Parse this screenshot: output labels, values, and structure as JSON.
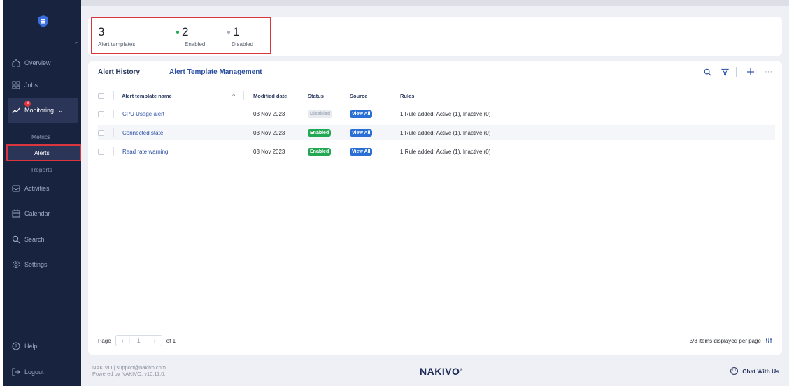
{
  "sidebar": {
    "items": [
      {
        "label": "Overview",
        "icon": "home-icon"
      },
      {
        "label": "Jobs",
        "icon": "grid-icon"
      },
      {
        "label": "Monitoring",
        "icon": "chart-line-icon",
        "badge": "6"
      },
      {
        "label": "Activities",
        "icon": "inbox-icon"
      },
      {
        "label": "Calendar",
        "icon": "calendar-icon"
      },
      {
        "label": "Search",
        "icon": "search-icon"
      },
      {
        "label": "Settings",
        "icon": "gear-icon"
      }
    ],
    "subitems": [
      "Metrics",
      "Alerts",
      "Reports"
    ],
    "bottom": [
      {
        "label": "Help",
        "icon": "help-icon"
      },
      {
        "label": "Logout",
        "icon": "logout-icon"
      }
    ]
  },
  "stats": [
    {
      "value": "3",
      "label": "Alert templates",
      "dot_color": ""
    },
    {
      "value": "2",
      "label": "Enabled",
      "dot_color": "#22a852"
    },
    {
      "value": "1",
      "label": "Disabled",
      "dot_color": "#a6adba"
    }
  ],
  "tabs": [
    "Alert History",
    "Alert Template Management"
  ],
  "table": {
    "columns": [
      "Alert template name",
      "Modified date",
      "Status",
      "Source",
      "Rules"
    ],
    "sort_indicator": "^",
    "rows": [
      {
        "name": "CPU Usage alert",
        "date": "03 Nov 2023",
        "status": "Disabled",
        "source": "View All",
        "rules": "1 Rule added: Active (1), Inactive (0)"
      },
      {
        "name": "Connected state",
        "date": "03 Nov 2023",
        "status": "Enabled",
        "source": "View All",
        "rules": "1 Rule added: Active (1), Inactive (0)"
      },
      {
        "name": "Read rate warning",
        "date": "03 Nov 2023",
        "status": "Enabled",
        "source": "View All",
        "rules": "1 Rule added: Active (1), Inactive (0)"
      }
    ]
  },
  "pager": {
    "label": "Page",
    "current": "1",
    "of": "of 1"
  },
  "items_info": "3/3 items displayed per page",
  "footer": {
    "line1": "NAKIVO | support@nakivo.com",
    "line2": "Powered by NAKIVO. v10.11.0.",
    "brand": "NAKIVO",
    "chat": "Chat With Us"
  },
  "colors": {
    "sidebar_bg": "#18233f",
    "accent": "#2b4fa3",
    "highlight": "#d9363e",
    "enabled": "#22a852",
    "view_all": "#2a6fd6"
  }
}
